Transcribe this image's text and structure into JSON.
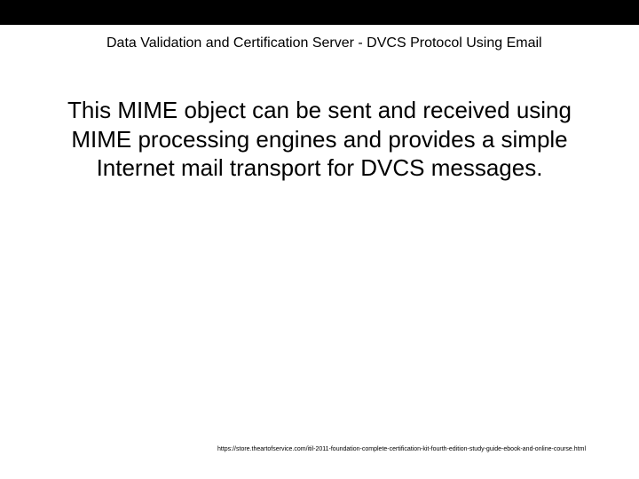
{
  "header": {
    "title": "Data Validation and Certification Server -  DVCS Protocol Using Email"
  },
  "main": {
    "body": "This MIME object can be sent and received using MIME processing engines and provides a simple Internet mail transport for DVCS messages."
  },
  "footer": {
    "url": "https://store.theartofservice.com/itil-2011-foundation-complete-certification-kit-fourth-edition-study-guide-ebook-and-online-course.html"
  }
}
